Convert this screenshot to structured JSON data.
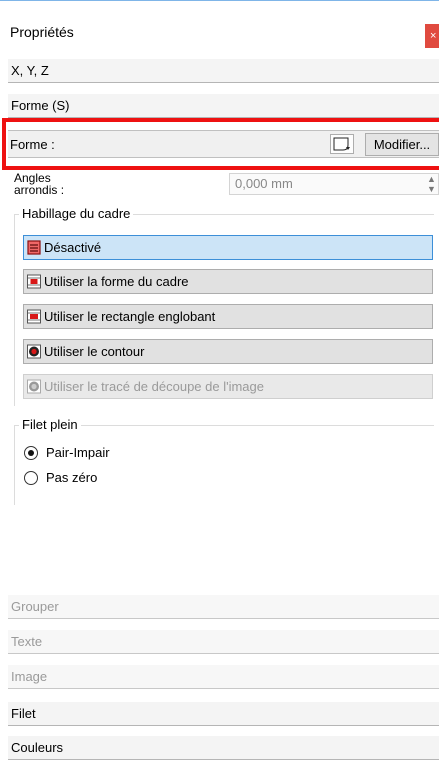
{
  "panel": {
    "title": "Propriétés",
    "close_glyph": "×"
  },
  "sections": {
    "xyz": "X, Y, Z",
    "forme": "Forme (S)",
    "grouper": "Grouper",
    "texte": "Texte",
    "image": "Image",
    "filet": "Filet",
    "couleurs": "Couleurs"
  },
  "forme_row": {
    "label": "Forme :",
    "shape_icon": "rounded-rect-shape-icon",
    "modify_label": "Modifier..."
  },
  "angles": {
    "label_line1": "Angles",
    "label_line2": "arrondis :",
    "value": "0,000 mm"
  },
  "habillage": {
    "legend": "Habillage du cadre",
    "options": [
      {
        "label": "Désactivé",
        "selected": true,
        "enabled": true
      },
      {
        "label": "Utiliser la forme du cadre",
        "selected": false,
        "enabled": true
      },
      {
        "label": "Utiliser le rectangle englobant",
        "selected": false,
        "enabled": true
      },
      {
        "label": "Utiliser le contour",
        "selected": false,
        "enabled": true
      },
      {
        "label": "Utiliser le tracé de découpe de l'image",
        "selected": false,
        "enabled": false
      }
    ]
  },
  "filet_plein": {
    "legend": "Filet plein",
    "options": [
      {
        "label": "Pair-Impair",
        "checked": true
      },
      {
        "label": "Pas zéro",
        "checked": false
      }
    ]
  },
  "colors": {
    "accent": "#3c8fd8",
    "highlight": "#ee1111",
    "close": "#e04a3f"
  }
}
